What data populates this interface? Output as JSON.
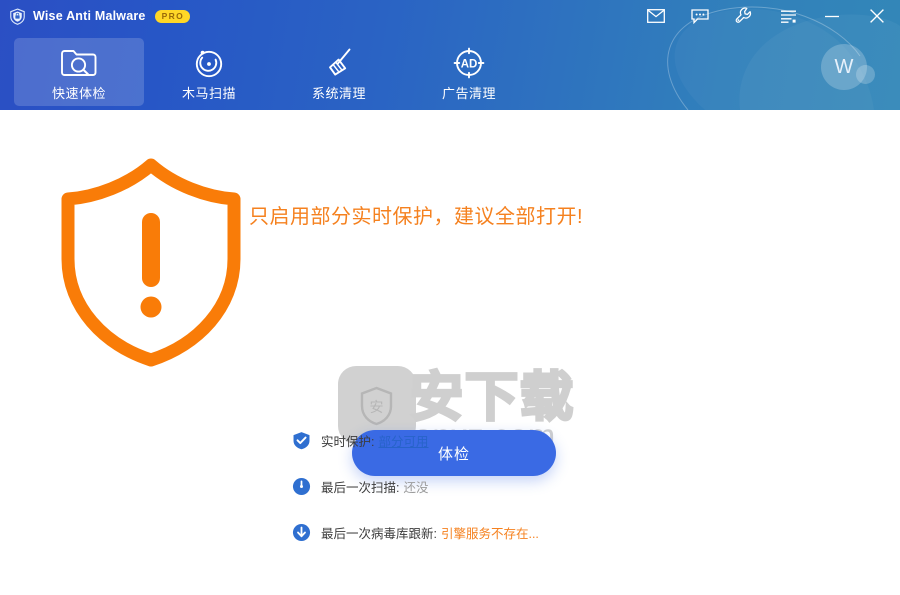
{
  "titlebar": {
    "logo_icon": "shield-logo-icon",
    "app_name": "Wise Anti Malware",
    "pro_badge": "PRO",
    "tools": [
      {
        "name": "mail-icon",
        "title": "Mail"
      },
      {
        "name": "feedback-icon",
        "title": "Feedback"
      },
      {
        "name": "wrench-icon",
        "title": "Tools"
      },
      {
        "name": "menu-icon",
        "title": "Menu"
      },
      {
        "name": "minimize-icon",
        "title": "Minimize"
      },
      {
        "name": "close-icon",
        "title": "Close"
      }
    ]
  },
  "nav": {
    "tabs": [
      {
        "label": "快速体检",
        "icon": "folder-search-icon",
        "active": true
      },
      {
        "label": "木马扫描",
        "icon": "radar-scan-icon",
        "active": false
      },
      {
        "label": "系统清理",
        "icon": "broom-icon",
        "active": false
      },
      {
        "label": "广告清理",
        "icon": "ad-target-icon",
        "active": false
      }
    ]
  },
  "account": {
    "avatar_initial": "W"
  },
  "main": {
    "status_shield_icon": "warning-shield-icon",
    "warning_text": "只启用部分实时保护，建议全部打开!",
    "scan_button_label": "体检",
    "status_rows": [
      {
        "icon": "shield-check-icon",
        "label": "实时保护:",
        "value": "部分可用",
        "value_style": "link"
      },
      {
        "icon": "clock-icon",
        "label": "最后一次扫描:",
        "value": "还没",
        "value_style": "muted"
      },
      {
        "icon": "download-arrow-icon",
        "label": "最后一次病毒库跟新:",
        "value": "引擎服务不存在...",
        "value_style": "warn"
      }
    ]
  },
  "watermark": {
    "cn_text": "安下载",
    "en_text": "anxz.com",
    "logo_glyph": "安"
  },
  "colors": {
    "header_start": "#2b4fc4",
    "header_end": "#3387b8",
    "accent_blue": "#3a6ae4",
    "warn_orange": "#f5811f",
    "badge_yellow": "#ffd727",
    "link_blue": "#2763c9"
  }
}
